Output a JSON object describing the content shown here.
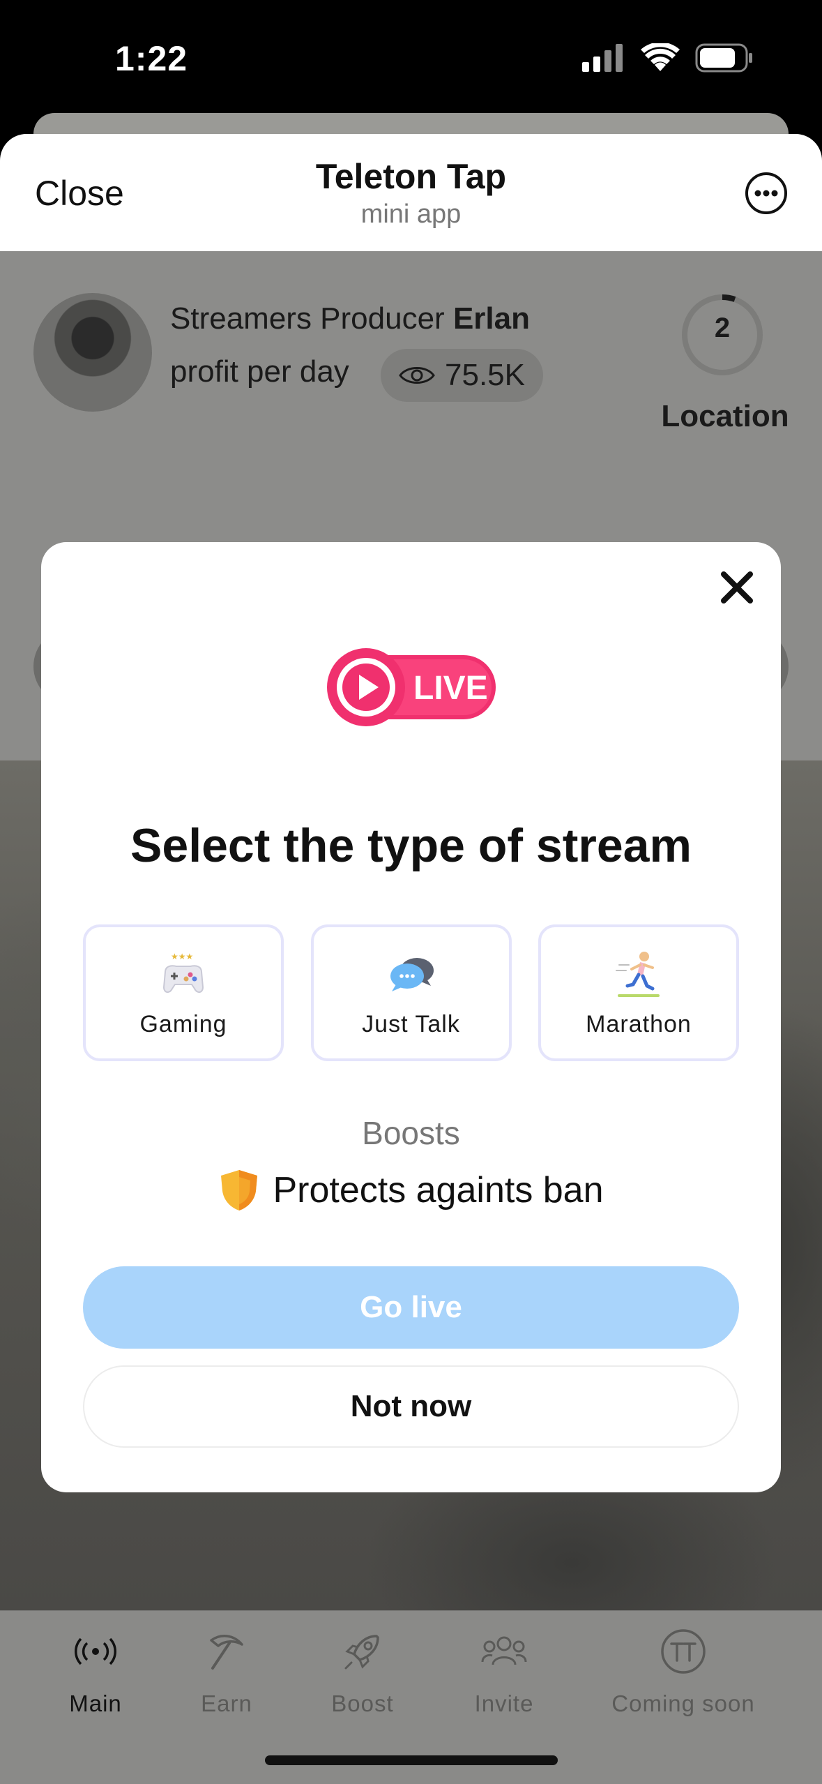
{
  "status_bar": {
    "time": "1:22"
  },
  "header": {
    "close_label": "Close",
    "title": "Teleton Tap",
    "subtitle": "mini app",
    "more_icon": "ellipsis-circle-icon"
  },
  "profile": {
    "role": "Streamers Producer",
    "name": "Erlan",
    "profit_label": "profit per day",
    "views": "75.5K",
    "location_number": "2",
    "location_label": "Location"
  },
  "modal": {
    "title": "Select the type of stream",
    "options": [
      {
        "label": "Gaming",
        "icon": "gamepad-icon"
      },
      {
        "label": "Just Talk",
        "icon": "chat-bubbles-icon"
      },
      {
        "label": "Marathon",
        "icon": "runner-icon"
      }
    ],
    "boosts_heading": "Boosts",
    "boost_text": "Protects againts ban",
    "live_logo_text": "LIVE",
    "go_live_label": "Go live",
    "not_now_label": "Not now"
  },
  "nav": {
    "items": [
      {
        "label": "Main",
        "icon": "broadcast-icon",
        "active": true
      },
      {
        "label": "Earn",
        "icon": "pickaxe-icon"
      },
      {
        "label": "Boost",
        "icon": "rocket-icon"
      },
      {
        "label": "Invite",
        "icon": "friends-icon"
      },
      {
        "label": "Coming soon",
        "icon": "tt-coin-icon"
      }
    ]
  },
  "colors": {
    "go_live_bg": "#a9d4fb",
    "live_logo": "#f0306e",
    "option_border": "#e4e4fb"
  }
}
